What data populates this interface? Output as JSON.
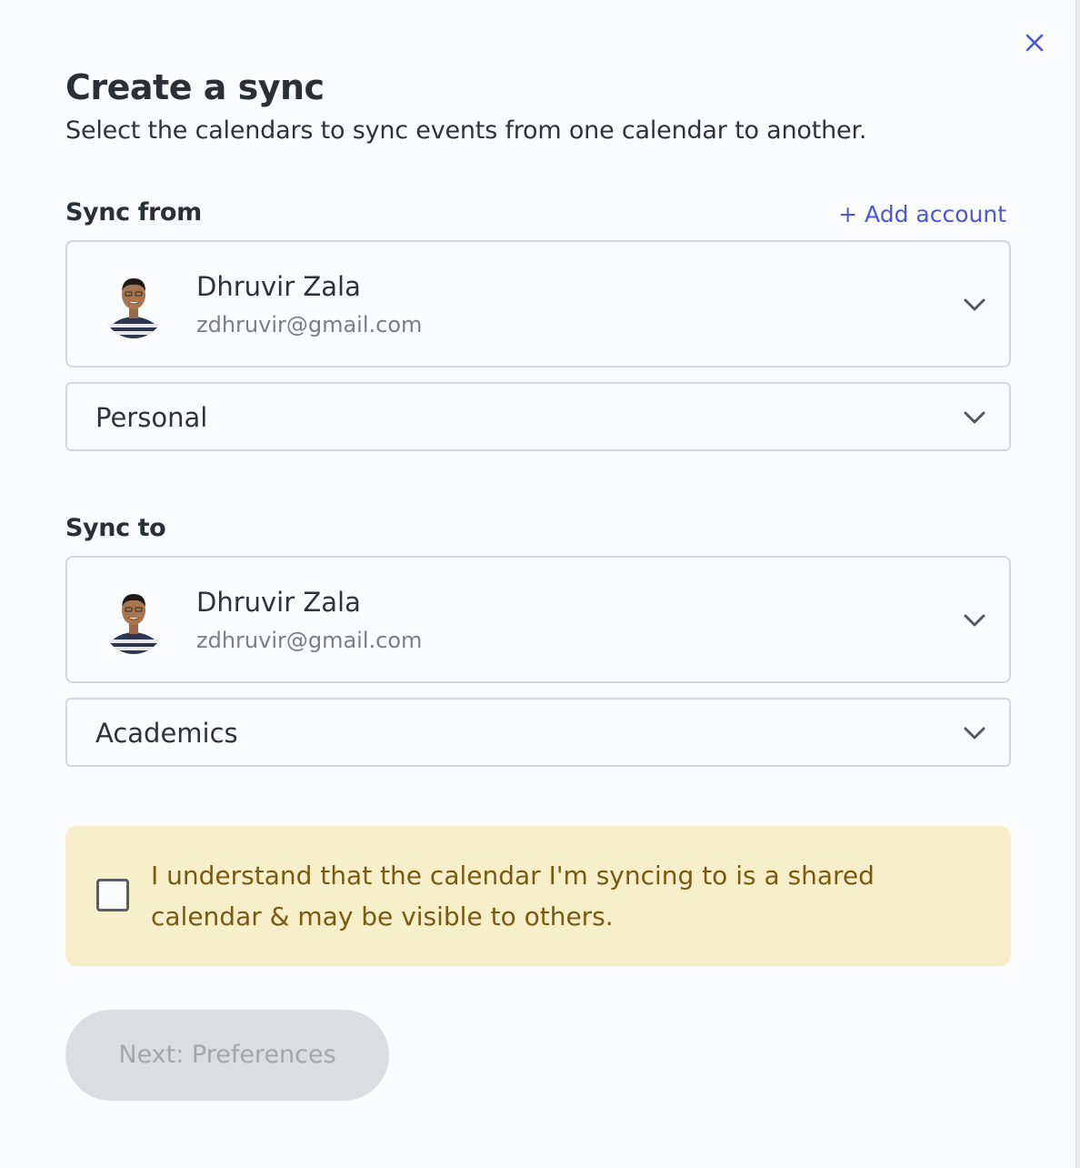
{
  "dialog": {
    "title": "Create a sync",
    "subtitle": "Select the calendars to sync events from one calendar to another.",
    "close_icon": "close-icon"
  },
  "sync_from": {
    "label": "Sync from",
    "add_account": "+ Add account",
    "account": {
      "name": "Dhruvir Zala",
      "email": "zdhruvir@gmail.com"
    },
    "calendar": "Personal"
  },
  "sync_to": {
    "label": "Sync to",
    "account": {
      "name": "Dhruvir Zala",
      "email": "zdhruvir@gmail.com"
    },
    "calendar": "Academics"
  },
  "notice": {
    "checked": false,
    "text_line1": "I understand that the calendar I'm syncing to is a shared",
    "text_line2": "calendar & may be visible to others."
  },
  "next_button": {
    "label": "Next: Preferences",
    "enabled": false
  },
  "colors": {
    "accent": "#4a57d8",
    "notice_bg": "#f6efca",
    "notice_text": "#7a5a10",
    "disabled_btn_bg": "#dcdde0"
  }
}
